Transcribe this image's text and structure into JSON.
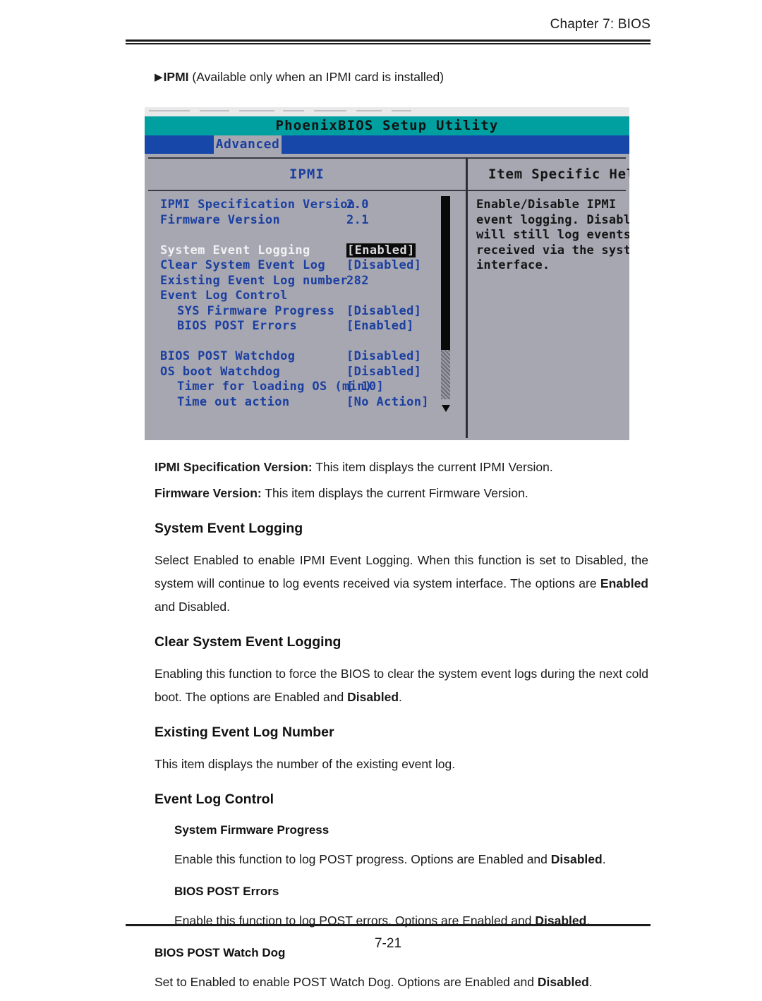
{
  "header": {
    "running_head": "Chapter 7: BIOS"
  },
  "intro": {
    "marker": "▶",
    "title": "IPMI",
    "note": " (Available only when an IPMI card is installed)"
  },
  "bios": {
    "title": "PhoenixBIOS Setup Utility",
    "menu_tab": "Advanced",
    "panel_title": "IPMI",
    "help_title": "Item Specific Help",
    "help_lines": [
      "Enable/Disable IPMI",
      "event logging. Disabling",
      "will still log events",
      "received via the system",
      "interface."
    ],
    "rows": [
      {
        "label": "IPMI Specification Version",
        "value": "2.0",
        "indent": false,
        "selected": false,
        "highlight": false
      },
      {
        "label": "Firmware Version",
        "value": "2.1",
        "indent": false,
        "selected": false,
        "highlight": false
      },
      {
        "label": "",
        "value": "",
        "spacer": true
      },
      {
        "label": "System Event Logging",
        "value": "[Enabled]",
        "indent": false,
        "selected": true,
        "highlight": true
      },
      {
        "label": "Clear System Event Log",
        "value": "[Disabled]",
        "indent": false,
        "selected": false,
        "highlight": false
      },
      {
        "label": "Existing Event Log number",
        "value": "282",
        "indent": false,
        "selected": false,
        "highlight": false
      },
      {
        "label": "Event Log Control",
        "value": "",
        "indent": false,
        "selected": false,
        "highlight": false
      },
      {
        "label": "SYS Firmware Progress",
        "value": "[Disabled]",
        "indent": true,
        "selected": false,
        "highlight": false
      },
      {
        "label": "BIOS POST Errors",
        "value": "[Enabled]",
        "indent": true,
        "selected": false,
        "highlight": false
      },
      {
        "label": "",
        "value": "",
        "spacer": true
      },
      {
        "label": "BIOS POST Watchdog",
        "value": "[Disabled]",
        "indent": false,
        "selected": false,
        "highlight": false
      },
      {
        "label": "OS boot Watchdog",
        "value": "[Disabled]",
        "indent": false,
        "selected": false,
        "highlight": false
      },
      {
        "label": "Timer for loading OS (min)",
        "value": "[ 10]",
        "indent": true,
        "selected": false,
        "highlight": false
      },
      {
        "label": "Time out action",
        "value": "[No Action]",
        "indent": true,
        "selected": false,
        "highlight": false
      }
    ],
    "colors": {
      "title_bar": "#00a0a0",
      "menu_bar": "#1747a8",
      "panel": "#a7a7b2",
      "label_blue": "#1b3fa0"
    }
  },
  "content": {
    "lead_items": [
      {
        "term": "IPMI Specification Version:",
        "text": " This item displays the current IPMI Version."
      },
      {
        "term": "Firmware Version:",
        "text": " This item displays the current Firmware Version."
      }
    ],
    "sections": [
      {
        "heading": "System Event Logging",
        "paragraph_html": "Select Enabled to enable IPMI Event Logging. When this function is set to Disabled, the system will continue to log events received via system interface. The options are <b>Enabled</b> and Disabled."
      },
      {
        "heading": "Clear System Event Logging",
        "paragraph_html": "Enabling this function to force the BIOS to clear the system event logs during the next cold boot. The options are Enabled and <b>Disabled</b>."
      },
      {
        "heading": "Existing Event Log Number",
        "paragraph_html": "This item displays the number of the existing event log."
      },
      {
        "heading": "Event Log Control",
        "paragraph_html": ""
      }
    ],
    "sub_sections": [
      {
        "heading": "System Firmware Progress",
        "paragraph_html": "Enable this function to log POST progress. Options are Enabled and <b>Disabled</b>.",
        "indent": true,
        "justify": true
      },
      {
        "heading": "BIOS POST Errors",
        "paragraph_html": "Enable this function to log POST errors. Options are Enabled and <b>Disabled</b>.",
        "indent": true,
        "justify": false
      },
      {
        "heading": "BIOS POST Watch Dog",
        "paragraph_html": "Set to Enabled to enable POST Watch Dog. Options are Enabled and <b>Disabled</b>.",
        "indent": false,
        "justify": false
      }
    ]
  },
  "footer": {
    "page_number": "7-21"
  }
}
